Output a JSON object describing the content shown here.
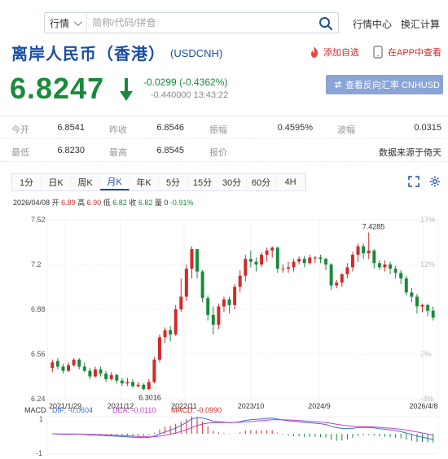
{
  "topbar": {
    "category": "行情",
    "search_placeholder": "简称/代码/拼音",
    "links": [
      "行情中心",
      "换汇计算"
    ]
  },
  "title": {
    "name": "离岸人民币（香港）",
    "code": "(USDCNH)"
  },
  "actions": {
    "watchlist": "添加自选",
    "app": "在APP中查看"
  },
  "quote": {
    "price": "6.8247",
    "change": "-0.0299 (-0.4362%)",
    "sub": "-0.440000 13:43:22",
    "reverse_btn": "查看反向汇率 CNHUSD"
  },
  "stats": {
    "row1": [
      {
        "label": "今开",
        "value": "6.8541"
      },
      {
        "label": "昨收",
        "value": "6.8546"
      },
      {
        "label": "振幅",
        "value": "0.4595%"
      },
      {
        "label": "波幅",
        "value": "0.0315"
      }
    ],
    "row2": [
      {
        "label": "最低",
        "value": "6.8230"
      },
      {
        "label": "最高",
        "value": "6.8545"
      },
      {
        "label": "报价",
        "value": ""
      },
      {
        "label": "",
        "value": "数据来源于倚天"
      }
    ]
  },
  "tabs": [
    "1分",
    "日K",
    "周K",
    "月K",
    "年K",
    "5分",
    "15分",
    "30分",
    "60分",
    "4H"
  ],
  "active_tab": "月K",
  "ohlc": {
    "date": "2026/04/08",
    "open_label": "开",
    "open": "6.89",
    "high_label": "高",
    "high": "6.90",
    "low_label": "低",
    "low": "6.82",
    "close_label": "收",
    "close": "6.82",
    "amount_label": "量",
    "amount": "0",
    "pct": "-0.91%"
  },
  "colors": {
    "up": "#d12a2a",
    "down": "#1a8a3a",
    "accent": "#1b4ea3",
    "macd_dif": "#3d6fd8",
    "macd_dea": "#c63fc6"
  },
  "chart_data": {
    "type": "candlestick",
    "yticks": [
      "7.52",
      "7.2",
      "6.88",
      "6.56",
      "6.24"
    ],
    "yticks_right": [
      "17%",
      "12%",
      "7%",
      "2%",
      "-3%"
    ],
    "ylim": [
      6.24,
      7.52
    ],
    "xticks": [
      "2021/1/29",
      "2021/12",
      "2022/11",
      "2023/10",
      "2024/9",
      "2026/4/8"
    ],
    "annotations": {
      "high_label": "7.4285",
      "low_label": "6.3016"
    },
    "candles": [
      [
        6.46,
        6.5,
        6.43,
        6.52
      ],
      [
        6.51,
        6.47,
        6.45,
        6.53
      ],
      [
        6.47,
        6.44,
        6.42,
        6.49
      ],
      [
        6.44,
        6.48,
        6.43,
        6.5
      ],
      [
        6.48,
        6.52,
        6.47,
        6.53
      ],
      [
        6.52,
        6.47,
        6.45,
        6.53
      ],
      [
        6.47,
        6.44,
        6.43,
        6.5
      ],
      [
        6.44,
        6.4,
        6.38,
        6.46
      ],
      [
        6.4,
        6.45,
        6.39,
        6.47
      ],
      [
        6.45,
        6.42,
        6.4,
        6.47
      ],
      [
        6.42,
        6.38,
        6.36,
        6.44
      ],
      [
        6.38,
        6.41,
        6.37,
        6.43
      ],
      [
        6.41,
        6.37,
        6.35,
        6.42
      ],
      [
        6.37,
        6.35,
        6.33,
        6.39
      ],
      [
        6.35,
        6.36,
        6.33,
        6.39
      ],
      [
        6.36,
        6.33,
        6.32,
        6.38
      ],
      [
        6.33,
        6.34,
        6.32,
        6.36
      ],
      [
        6.34,
        6.31,
        6.3,
        6.35
      ],
      [
        6.31,
        6.36,
        6.3,
        6.38
      ],
      [
        6.36,
        6.52,
        6.35,
        6.54
      ],
      [
        6.52,
        6.68,
        6.5,
        6.7
      ],
      [
        6.68,
        6.73,
        6.64,
        6.75
      ],
      [
        6.73,
        6.7,
        6.65,
        6.76
      ],
      [
        6.7,
        6.88,
        6.69,
        6.91
      ],
      [
        6.88,
        6.97,
        6.86,
        7.1
      ],
      [
        6.97,
        7.17,
        6.94,
        7.2
      ],
      [
        7.17,
        7.31,
        7.1,
        7.33
      ],
      [
        7.31,
        7.15,
        7.1,
        7.31
      ],
      [
        7.15,
        6.96,
        6.93,
        7.16
      ],
      [
        6.96,
        6.84,
        6.8,
        6.98
      ],
      [
        6.84,
        6.77,
        6.7,
        6.9
      ],
      [
        6.77,
        6.9,
        6.74,
        6.92
      ],
      [
        6.9,
        6.95,
        6.86,
        6.97
      ],
      [
        6.95,
        6.91,
        6.85,
        6.97
      ],
      [
        6.91,
        7.04,
        6.88,
        7.06
      ],
      [
        7.04,
        7.12,
        7.0,
        7.16
      ],
      [
        7.12,
        7.24,
        7.08,
        7.27
      ],
      [
        7.24,
        7.22,
        7.18,
        7.3
      ],
      [
        7.22,
        7.2,
        7.15,
        7.25
      ],
      [
        7.2,
        7.27,
        7.18,
        7.29
      ],
      [
        7.27,
        7.3,
        7.22,
        7.32
      ],
      [
        7.3,
        7.32,
        7.25,
        7.33
      ],
      [
        7.32,
        7.17,
        7.14,
        7.33
      ],
      [
        7.17,
        7.17,
        7.14,
        7.2
      ],
      [
        7.17,
        7.18,
        7.14,
        7.22
      ],
      [
        7.18,
        7.22,
        7.15,
        7.24
      ],
      [
        7.22,
        7.24,
        7.2,
        7.26
      ],
      [
        7.24,
        7.21,
        7.18,
        7.26
      ],
      [
        7.21,
        7.25,
        7.2,
        7.27
      ],
      [
        7.25,
        7.25,
        7.21,
        7.26
      ],
      [
        7.25,
        7.24,
        7.21,
        7.27
      ],
      [
        7.24,
        7.2,
        7.16,
        7.25
      ],
      [
        7.2,
        7.05,
        7.02,
        7.21
      ],
      [
        7.05,
        7.07,
        7.03,
        7.09
      ],
      [
        7.07,
        7.13,
        7.04,
        7.14
      ],
      [
        7.13,
        7.18,
        7.1,
        7.21
      ],
      [
        7.18,
        7.27,
        7.15,
        7.29
      ],
      [
        7.27,
        7.33,
        7.22,
        7.35
      ],
      [
        7.33,
        7.28,
        7.24,
        7.35
      ],
      [
        7.28,
        7.3,
        7.24,
        7.43
      ],
      [
        7.3,
        7.21,
        7.17,
        7.31
      ],
      [
        7.21,
        7.18,
        7.16,
        7.23
      ],
      [
        7.18,
        7.2,
        7.15,
        7.23
      ],
      [
        7.2,
        7.17,
        7.13,
        7.22
      ],
      [
        7.17,
        7.14,
        7.1,
        7.19
      ],
      [
        7.14,
        7.1,
        7.06,
        7.16
      ],
      [
        7.1,
        7.0,
        6.98,
        7.12
      ],
      [
        7.0,
        6.97,
        6.93,
        7.03
      ],
      [
        6.97,
        6.9,
        6.85,
        6.99
      ],
      [
        6.9,
        6.91,
        6.86,
        6.92
      ],
      [
        6.91,
        6.87,
        6.83,
        6.92
      ],
      [
        6.87,
        6.82,
        6.8,
        6.9
      ]
    ],
    "macd": {
      "dif_label": "DIF:",
      "dif": "-0.0604",
      "dea_label": "DEA:",
      "dea": "-0.0110",
      "macd_label": "MACD:",
      "macd": "-0.0990",
      "ylabels": [
        "1",
        "-1"
      ]
    }
  }
}
